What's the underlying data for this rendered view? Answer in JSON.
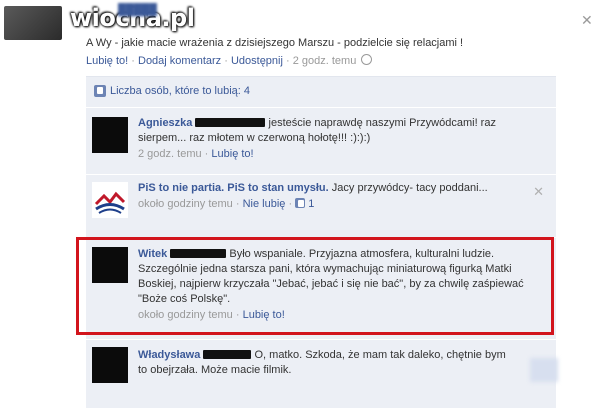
{
  "watermark": {
    "text": "wiocha.pl"
  },
  "post": {
    "text": "A Wy - jakie macie wrażenia z dzisiejszego Marszu - podzielcie się relacjami !",
    "actions": {
      "like": "Lubię to!",
      "comment": "Dodaj komentarz",
      "share": "Udostępnij",
      "time": "2 godz. temu"
    }
  },
  "likes_row": {
    "text": "Liczba osób, które to lubią: 4"
  },
  "comments": [
    {
      "name": "Agnieszka",
      "text": "jesteście naprawdę naszymi Przywódcami! raz sierpem... raz młotem w czerwoną hołotę!!! :):):)",
      "time": "2 godz. temu",
      "like": "Lubię to!"
    },
    {
      "name": "PiS to nie partia. PiS to stan umysłu.",
      "text": "Jacy przywódcy- tacy poddani...",
      "time": "około godziny temu",
      "unlike": "Nie lubię",
      "like_count": "1"
    },
    {
      "name": "Witek",
      "text": "Było wspaniale. Przyjazna atmosfera, kulturalni ludzie. Szczególnie jedna starsza pani, która wymachując miniaturową figurką Matki Boskiej, najpierw krzyczała \"Jebać, jebać i się nie bać\", by za chwilę zaśpiewać \"Boże coś Polskę\".",
      "time": "około godziny temu",
      "like": "Lubię to!"
    },
    {
      "name": "Władysława",
      "text": "O, matko. Szkoda, że mam tak daleko, chętnie bym to obejrzała. Może macie filmik."
    }
  ],
  "colors": {
    "link": "#3b5998",
    "highlight": "#d2141c",
    "panel": "#eceff5"
  }
}
